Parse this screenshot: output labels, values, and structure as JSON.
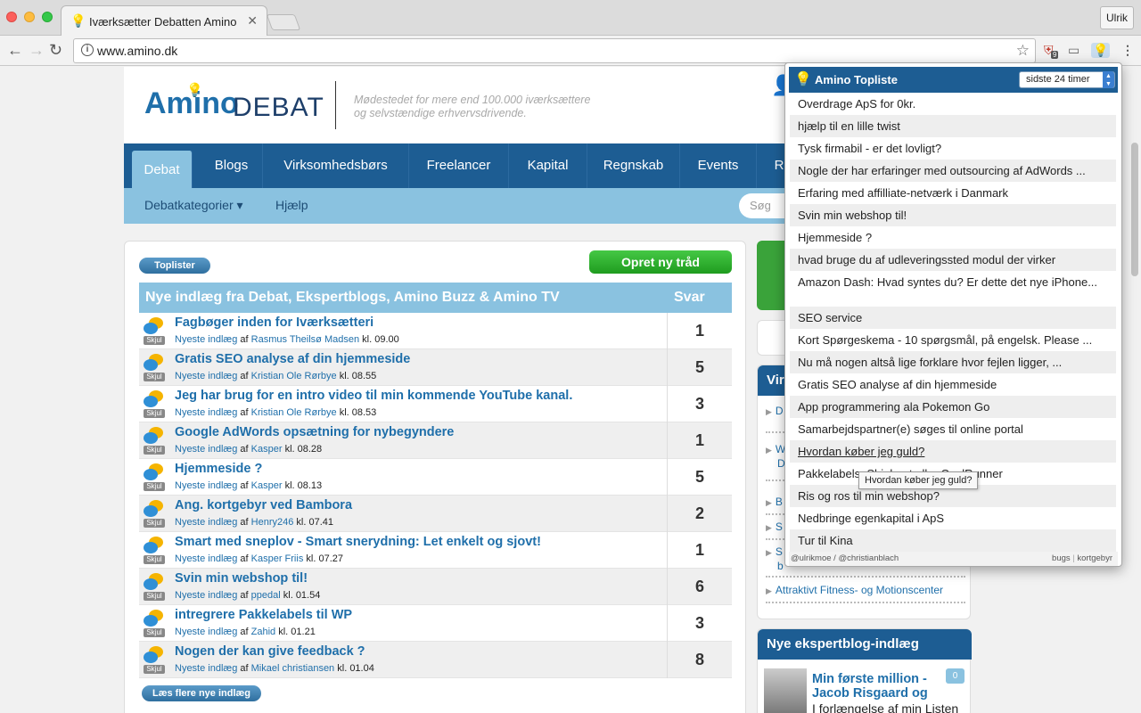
{
  "browser": {
    "tab_title": "Iværksætter Debatten Amino",
    "tab_close": "✕",
    "profile": "Ulrik",
    "url": "www.amino.dk",
    "ext_badge": "9"
  },
  "site": {
    "logo_amino": "Amino",
    "logo_debat": "DEBAT",
    "tagline": "Mødestedet for mere end 100.000 iværksættere og selvstændige erhvervsdrivende.",
    "nav": [
      "Debat",
      "Blogs",
      "Virksomhedsbørs",
      "Freelancer",
      "Kapital",
      "Regnskab",
      "Events",
      "R"
    ],
    "subnav": {
      "categories": "Debatkategorier ▾",
      "help": "Hjælp"
    },
    "search_placeholder": "Søg"
  },
  "content": {
    "toplister_btn": "Toplister",
    "new_thread_btn": "Opret ny tråd",
    "table_title": "Nye indlæg fra Debat, Ekspertblogs, Amino Buzz & Amino TV",
    "table_svar": "Svar",
    "skjul": "Skjul",
    "meta_prefix": "Nyeste indlæg",
    "meta_af": "af",
    "meta_kl": "kl.",
    "rows": [
      {
        "title": "Fagbøger inden for Iværksætteri",
        "author": "Rasmus Theilsø Madsen",
        "time": "09.00",
        "count": "1"
      },
      {
        "title": "Gratis SEO analyse af din hjemmeside",
        "author": "Kristian Ole Rørbye",
        "time": "08.55",
        "count": "5"
      },
      {
        "title": "Jeg har brug for en intro video til min kommende YouTube kanal.",
        "author": "Kristian Ole Rørbye",
        "time": "08.53",
        "count": "3"
      },
      {
        "title": "Google AdWords opsætning for nybegyndere",
        "author": "Kasper",
        "time": "08.28",
        "count": "1"
      },
      {
        "title": "Hjemmeside ?",
        "author": "Kasper",
        "time": "08.13",
        "count": "5"
      },
      {
        "title": "Ang. kortgebyr ved Bambora",
        "author": "Henry246",
        "time": "07.41",
        "count": "2"
      },
      {
        "title": "Smart med sneplov - Smart snerydning: Let enkelt og sjovt!",
        "author": "Kasper Friis",
        "time": "07.27",
        "count": "1"
      },
      {
        "title": "Svin min webshop til!",
        "author": "ppedal",
        "time": "01.54",
        "count": "6"
      },
      {
        "title": "intregrere Pakkelabels til WP",
        "author": "Zahid",
        "time": "01.21",
        "count": "3"
      },
      {
        "title": "Nogen der kan give feedback ?",
        "author": "Mikael christiansen",
        "time": "01.04",
        "count": "8"
      }
    ],
    "more_btn": "Læs flere nye indlæg"
  },
  "sidebar": {
    "box_title": "Vir",
    "links": [
      "D",
      "W",
      "D",
      "B",
      "S",
      "S",
      "b"
    ],
    "last_link": "Attraktivt Fitness- og Motionscenter",
    "expert_title": "Nye ekspertblog-indlæg",
    "expert_post_title": "Min første million - Jacob Risgaard og",
    "expert_post_sub": "I forlængelse af min Listen",
    "expert_count": "0"
  },
  "popup": {
    "title": "Amino Topliste",
    "select_value": "sidste 24 timer",
    "items": [
      "Overdrage ApS for 0kr.",
      "hjælp til en lille twist",
      "Tysk firmabil - er det lovligt?",
      "Nogle der har erfaringer med outsourcing af AdWords ...",
      "Erfaring med affilliate-netværk i Danmark",
      "Svin min webshop til!",
      "Hjemmeside ?",
      "hvad bruge du af udleveringssted modul der virker",
      "Amazon Dash: Hvad syntes du? Er dette det nye iPhone...",
      "SEO service",
      "Kort Spørgeskema - 10 spørgsmål, på engelsk. Please ...",
      "Nu må nogen altså lige forklare hvor fejlen ligger, ...",
      "Gratis SEO analyse af din hjemmeside",
      "App programmering ala Pokemon Go",
      "Samarbejdspartner(e) søges til online portal",
      "Hvordan køber jeg guld?",
      "Pakkelabels, Shipboot eller CoolRunner",
      "Ris og ros til min webshop?",
      "Nedbringe egenkapital i ApS",
      "Tur til Kina"
    ],
    "footer_left": "@ulrikmoe / @christianblach",
    "footer_bugs": "bugs",
    "footer_sep": "|",
    "footer_fee": "kortgebyr",
    "tooltip": "Hvordan køber jeg guld?"
  }
}
